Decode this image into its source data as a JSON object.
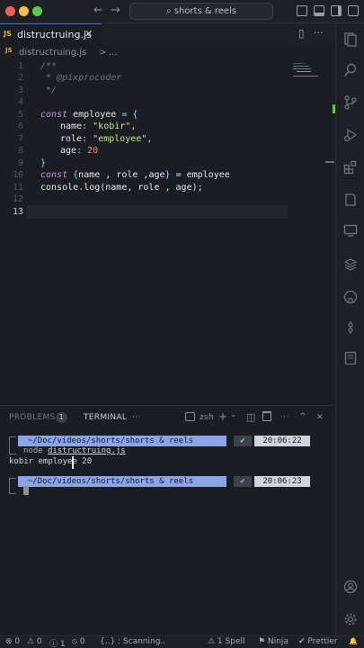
{
  "titlebar": {
    "search_label": "⌕ shorts & reels",
    "back_arrow": "←",
    "forward_arrow": "→"
  },
  "tab": {
    "badge": "JS",
    "label": "distructruing.js",
    "close": "✕"
  },
  "tab_actions": {
    "split": "▯",
    "more": "···"
  },
  "breadcrumb": {
    "badge": "JS",
    "file": "distructruing.js",
    "sep": ">",
    "more": "..."
  },
  "editor": {
    "line_numbers": [
      "1",
      "2",
      "3",
      "4",
      "5",
      "6",
      "7",
      "8",
      "9",
      "10",
      "11",
      "12",
      "13"
    ],
    "lines": {
      "l1": "/**",
      "l2": " * @pixprocoder",
      "l3": " */",
      "l5_kw": "const",
      "l5_name": "employee",
      "l5_rest": "= {",
      "l6_key": "name",
      "l6_colon": ":",
      "l6_val": "\"kobir\"",
      "l6_comma": ",",
      "l7_key": "role",
      "l7_colon": ":",
      "l7_val": "\"employee\"",
      "l7_comma": ",",
      "l8_key": "age",
      "l8_colon": ":",
      "l8_val": "20",
      "l9": "}",
      "l10_kw": "const",
      "l10_open": "{",
      "l10_vars": "name , role ,age",
      "l10_close": "}",
      "l10_rest": "= employee",
      "l11_obj": "console",
      "l11_rest": ".log(name, role , age);"
    }
  },
  "panel": {
    "problems_label": "PROBLEMS",
    "problems_count": "1",
    "terminal_label": "TERMINAL",
    "more": "···",
    "shell": "zsh",
    "add": "+",
    "dropdown": "⌄",
    "split": "◫",
    "trash": "🗑",
    "more2": "···",
    "maximize": "^",
    "close": "✕",
    "prompt1_path": "  ~/Doc/videos/shorts/shorts & reels",
    "prompt1_check": "✔",
    "prompt1_time": "20:06:22",
    "command_prefix": "node ",
    "command_file": "distructruing.js",
    "output": "kobir employee 20",
    "prompt2_path": "  ~/Doc/videos/shorts/shorts & reels",
    "prompt2_check": "✔",
    "prompt2_time": "20:06:23"
  },
  "statusbar": {
    "errors": "⊗ 0",
    "warnings": "⚠ 0",
    "info": "ⓘ 1",
    "ports": "⦸ 0",
    "scanning": "{..} : Scanning..",
    "spell": "⚠ 1 Spell",
    "ninja": "⚑ Ninja",
    "prettier": "✔ Prettier",
    "bell": "🔔"
  },
  "colors": {
    "close_dot": "#ee5f57",
    "min_dot": "#f5be4f",
    "max_dot": "#5bc84f",
    "accent": "#2f6fd0",
    "js_yellow": "#d7b43a"
  }
}
